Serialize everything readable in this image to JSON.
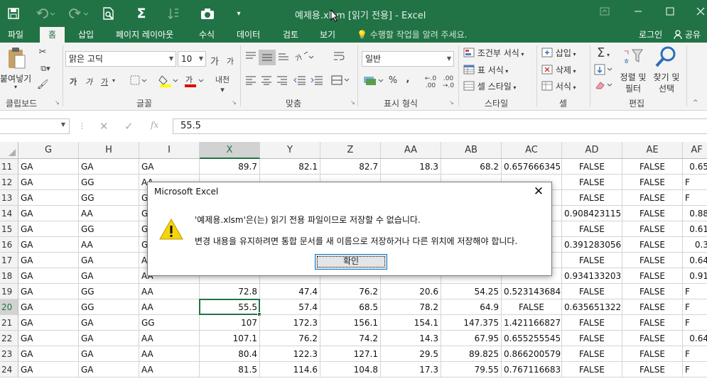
{
  "titlebar": {
    "title": "예제용.xlsm  [읽기 전용] - Excel",
    "qa_icons": [
      "save-icon",
      "undo-icon",
      "redo-icon",
      "print-preview-icon",
      "autosum-icon",
      "sort-icon",
      "camera-icon",
      "customize-qa-icon"
    ],
    "window_controls": [
      "ribbon-display-icon",
      "minimize-icon",
      "maximize-icon",
      "close-icon"
    ]
  },
  "menu": {
    "items": [
      "파일",
      "홈",
      "삽입",
      "페이지 레이아웃",
      "수식",
      "데이터",
      "검토",
      "보기"
    ],
    "tell_me": "수행할 작업을 알려 주세요.",
    "login": "로그인",
    "share": "공유"
  },
  "ribbon": {
    "clipboard": {
      "paste": "붙여넣기",
      "label": "클립보드"
    },
    "font": {
      "name": "맑은 고딕",
      "size": "10",
      "label": "글꼴",
      "bold": "가",
      "italic": "가",
      "underline": "가"
    },
    "alignment": {
      "label": "맞춤"
    },
    "number": {
      "format": "일반",
      "percent": "%",
      "comma": ",",
      "label": "표시 형식"
    },
    "styles": {
      "conditional": "조건부 서식",
      "table": "표 서식",
      "cell_style": "셀 스타일",
      "label": "스타일"
    },
    "cells": {
      "insert": "삽입",
      "delete": "삭제",
      "format": "서식",
      "label": "셀"
    },
    "editing": {
      "sort_filter": "정렬 및 필터",
      "find_select": "찾기 및 선택",
      "label": "편집"
    }
  },
  "formula_bar": {
    "value": "55.5",
    "fx": "fx"
  },
  "grid": {
    "columns": [
      "G",
      "H",
      "I",
      "X",
      "Y",
      "Z",
      "AA",
      "AB",
      "AC",
      "AD",
      "AE",
      "AF"
    ],
    "selected_column": "X",
    "selected_row": "20",
    "rows": [
      {
        "n": "11",
        "c": [
          "GA",
          "GA",
          "GA",
          "89.7",
          "82.1",
          "82.7",
          "18.3",
          "68.2",
          "0.657666345",
          "FALSE",
          "FALSE",
          "0.65"
        ]
      },
      {
        "n": "12",
        "c": [
          "GA",
          "GG",
          "AA",
          "",
          "",
          "",
          "",
          "",
          "",
          "FALSE",
          "FALSE",
          "F"
        ]
      },
      {
        "n": "13",
        "c": [
          "GA",
          "GG",
          "G",
          "",
          "",
          "",
          "",
          "",
          "",
          "FALSE",
          "FALSE",
          "F"
        ]
      },
      {
        "n": "14",
        "c": [
          "GA",
          "AA",
          "G",
          "",
          "",
          "",
          "",
          "",
          "",
          "0.908423115",
          "FALSE",
          "0.88"
        ]
      },
      {
        "n": "15",
        "c": [
          "GA",
          "GG",
          "G",
          "",
          "",
          "",
          "",
          "",
          "",
          "FALSE",
          "FALSE",
          "0.61"
        ]
      },
      {
        "n": "16",
        "c": [
          "GA",
          "AA",
          "G",
          "",
          "",
          "",
          "",
          "",
          "",
          "0.391283056",
          "FALSE",
          "0.3"
        ]
      },
      {
        "n": "17",
        "c": [
          "GA",
          "GA",
          "A",
          "",
          "",
          "",
          "",
          "",
          "",
          "FALSE",
          "FALSE",
          "0.64"
        ]
      },
      {
        "n": "18",
        "c": [
          "GA",
          "GA",
          "AA",
          "",
          "",
          "",
          "",
          "",
          "",
          "0.934133203",
          "FALSE",
          "0.91"
        ]
      },
      {
        "n": "19",
        "c": [
          "GA",
          "GG",
          "AA",
          "72.8",
          "47.4",
          "76.2",
          "20.6",
          "54.25",
          "0.523143684",
          "FALSE",
          "FALSE",
          "F"
        ]
      },
      {
        "n": "20",
        "c": [
          "GA",
          "GG",
          "AA",
          "55.5",
          "57.4",
          "68.5",
          "78.2",
          "64.9",
          "FALSE",
          "0.635651322",
          "FALSE",
          "F"
        ]
      },
      {
        "n": "21",
        "c": [
          "GA",
          "GA",
          "GG",
          "107",
          "172.3",
          "156.1",
          "154.1",
          "147.375",
          "1.421166827",
          "FALSE",
          "FALSE",
          "F"
        ]
      },
      {
        "n": "22",
        "c": [
          "GA",
          "GA",
          "AA",
          "107.1",
          "76.2",
          "74.2",
          "14.3",
          "67.95",
          "0.655255545",
          "FALSE",
          "FALSE",
          "0.64"
        ]
      },
      {
        "n": "23",
        "c": [
          "GA",
          "GA",
          "AA",
          "80.4",
          "122.3",
          "127.1",
          "29.5",
          "89.825",
          "0.866200579",
          "FALSE",
          "FALSE",
          "F"
        ]
      },
      {
        "n": "24",
        "c": [
          "GA",
          "GA",
          "AA",
          "81.5",
          "114.6",
          "104.8",
          "17.3",
          "79.55",
          "0.767116683",
          "FALSE",
          "FALSE",
          "F"
        ]
      }
    ]
  },
  "dialog": {
    "title": "Microsoft Excel",
    "message1": "'예제용.xlsm'은(는) 읽기 전용 파일이므로 저장할 수 없습니다.",
    "message2": "변경 내용을 유지하려면 통합 문서를 새 이름으로 저장하거나 다른 위치에 저장해야 합니다.",
    "ok_label": "확인",
    "icon": "warning-icon"
  },
  "colors": {
    "accent": "#217346",
    "dialog_button_border": "#0078d7",
    "warning": "#f7d40a"
  }
}
